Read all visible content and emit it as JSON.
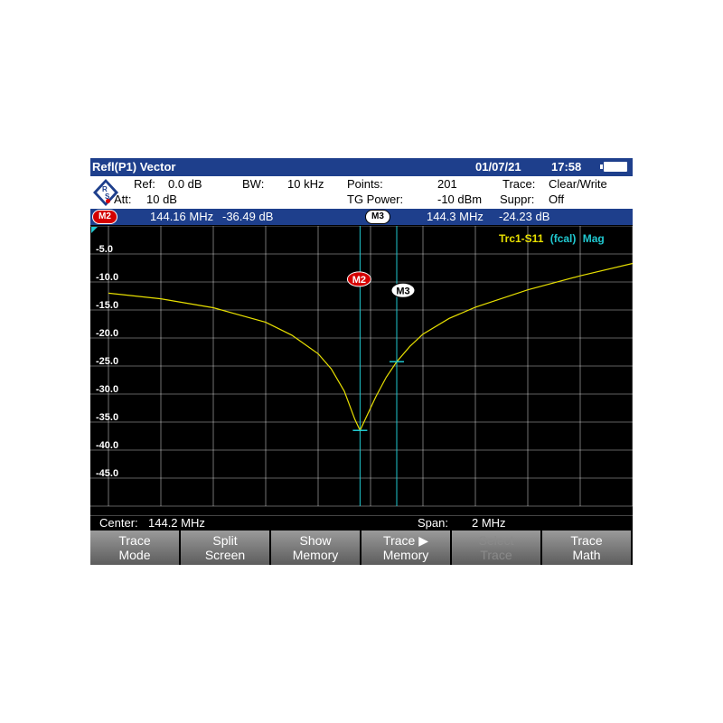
{
  "title_bar": {
    "mode": "Refl(P1) Vector",
    "date": "01/07/21",
    "time": "17:58"
  },
  "info": {
    "ref_label": "Ref:",
    "ref_value": "0.0 dB",
    "att_label": "Att:",
    "att_value": "10 dB",
    "bw_label": "BW:",
    "bw_value": "10 kHz",
    "points_label": "Points:",
    "points_value": "201",
    "tg_label": "TG Power:",
    "tg_value": "-10 dBm",
    "trace_label": "Trace:",
    "trace_value": "Clear/Write",
    "suppr_label": "Suppr:",
    "suppr_value": "Off"
  },
  "marker_bar": {
    "m2_label": "M2",
    "m2_freq": "144.16 MHz",
    "m2_level": "-36.49 dB",
    "m3_label": "M3",
    "m3_freq": "144.3 MHz",
    "m3_level": "-24.23 dB"
  },
  "trace_label": {
    "name": "Trc1-S11",
    "cal": "(fcal)",
    "format": "Mag"
  },
  "status": {
    "center_label": "Center:",
    "center_value": "144.2 MHz",
    "span_label": "Span:",
    "span_value": "2 MHz"
  },
  "softkeys": [
    {
      "line1": "Trace",
      "line2": "Mode"
    },
    {
      "line1": "Split",
      "line2": "Screen"
    },
    {
      "line1": "Show",
      "line2": "Memory"
    },
    {
      "line1": "Trace ▶",
      "line2": "Memory"
    },
    {
      "line1": "Select",
      "line2": "Trace"
    },
    {
      "line1": "Trace",
      "line2": "Math"
    }
  ],
  "colors": {
    "header": "#1e3f8c",
    "trace": "#e8e000",
    "marker_line": "#20c8d0",
    "grid": "#ffffff",
    "marker_red": "#d40000"
  },
  "chart_data": {
    "type": "line",
    "x_center_mhz": 144.2,
    "x_span_mhz": 2,
    "xlim": [
      143.2,
      145.2
    ],
    "ylim": [
      -50,
      0
    ],
    "y_ticks": [
      "-5.0",
      "-10.0",
      "-15.0",
      "-20.0",
      "-25.0",
      "-30.0",
      "-35.0",
      "-40.0",
      "-45.0"
    ],
    "grid": true,
    "series": [
      {
        "name": "Trc1-S11",
        "x": [
          143.2,
          143.4,
          143.6,
          143.8,
          143.9,
          144.0,
          144.05,
          144.1,
          144.14,
          144.16,
          144.18,
          144.22,
          144.26,
          144.3,
          144.35,
          144.4,
          144.5,
          144.6,
          144.8,
          145.0,
          145.2
        ],
        "y": [
          -12.0,
          -13.0,
          -14.6,
          -17.2,
          -19.5,
          -22.8,
          -25.5,
          -29.5,
          -34.5,
          -36.49,
          -34.5,
          -30.5,
          -27.0,
          -24.23,
          -21.5,
          -19.3,
          -16.5,
          -14.5,
          -11.4,
          -8.9,
          -6.7
        ]
      }
    ],
    "markers": [
      {
        "label": "M2",
        "x": 144.16,
        "y": -36.49
      },
      {
        "label": "M3",
        "x": 144.3,
        "y": -24.23
      }
    ]
  }
}
